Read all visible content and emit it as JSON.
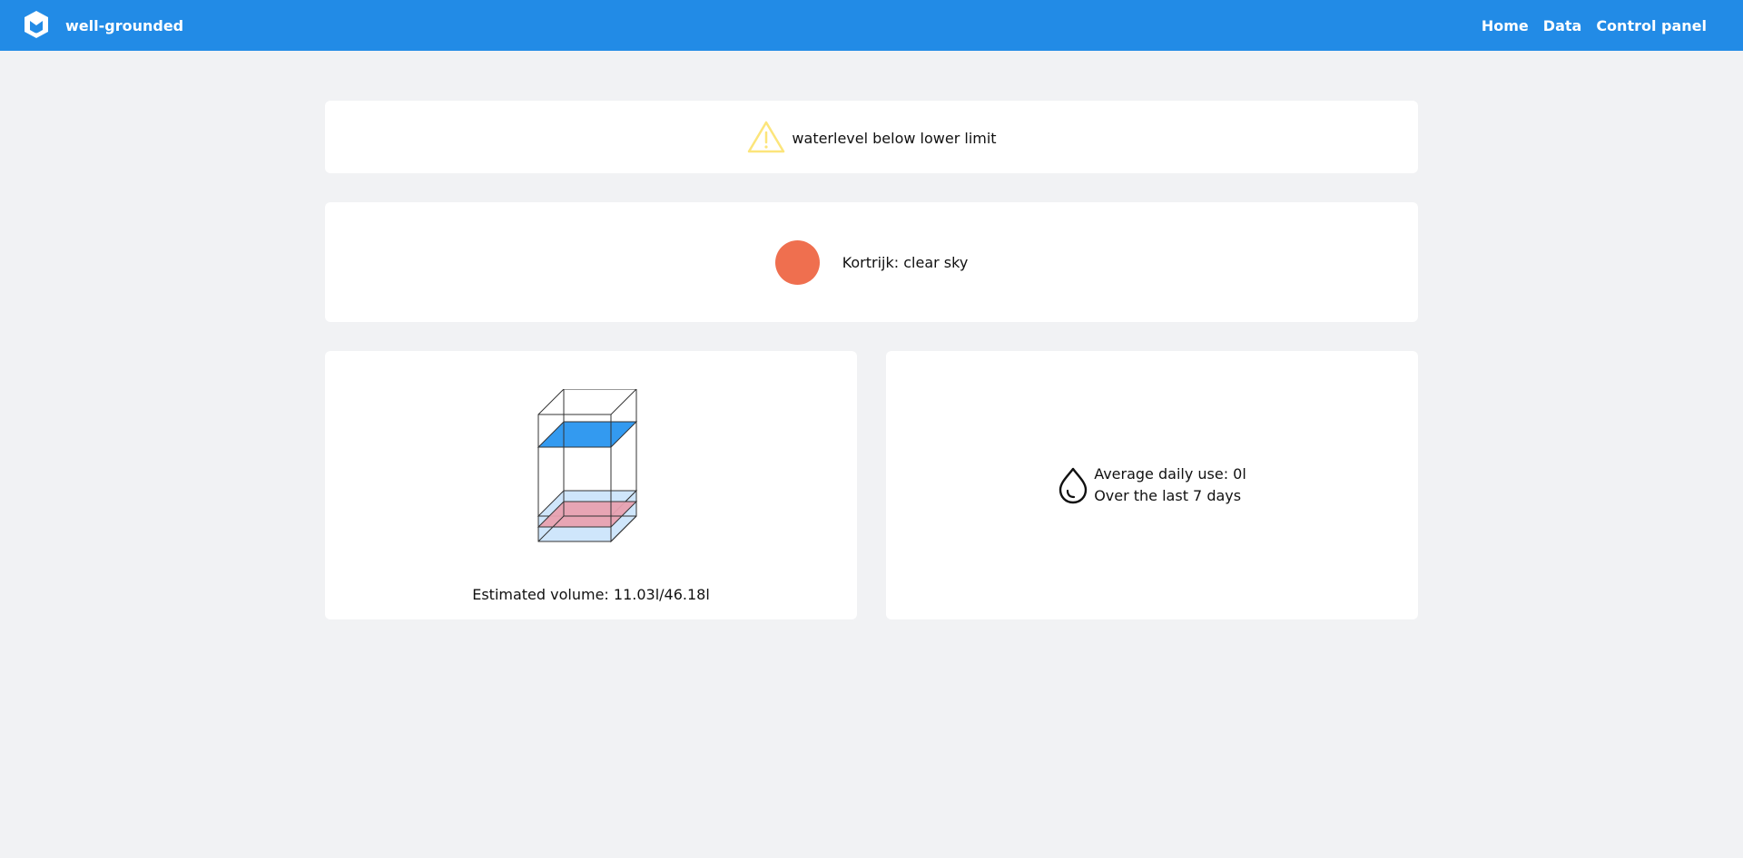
{
  "header": {
    "brand": "well-grounded",
    "logo_icon": "mantine-logo-icon",
    "nav": [
      {
        "label": "Home"
      },
      {
        "label": "Data"
      },
      {
        "label": "Control panel"
      }
    ]
  },
  "alert": {
    "icon": "warning-triangle-icon",
    "message": "waterlevel below lower limit",
    "color": "#fce57b"
  },
  "weather": {
    "icon": "sun-icon",
    "text": "Kortrijk: clear sky",
    "color": "#ef6f4f"
  },
  "tank": {
    "volume_label": "Estimated volume: 11.03l/46.18l",
    "current_volume": 11.03,
    "total_volume": 46.18,
    "water_color": "#cfe6fb",
    "upper_limit_color": "#339af0",
    "lower_limit_color": "#e8a1b0"
  },
  "usage": {
    "icon": "water-drop-icon",
    "line1": "Average daily use: 0l",
    "line2": "Over the last 7 days"
  },
  "colors": {
    "primary": "#228be6",
    "background": "#f1f2f4"
  }
}
